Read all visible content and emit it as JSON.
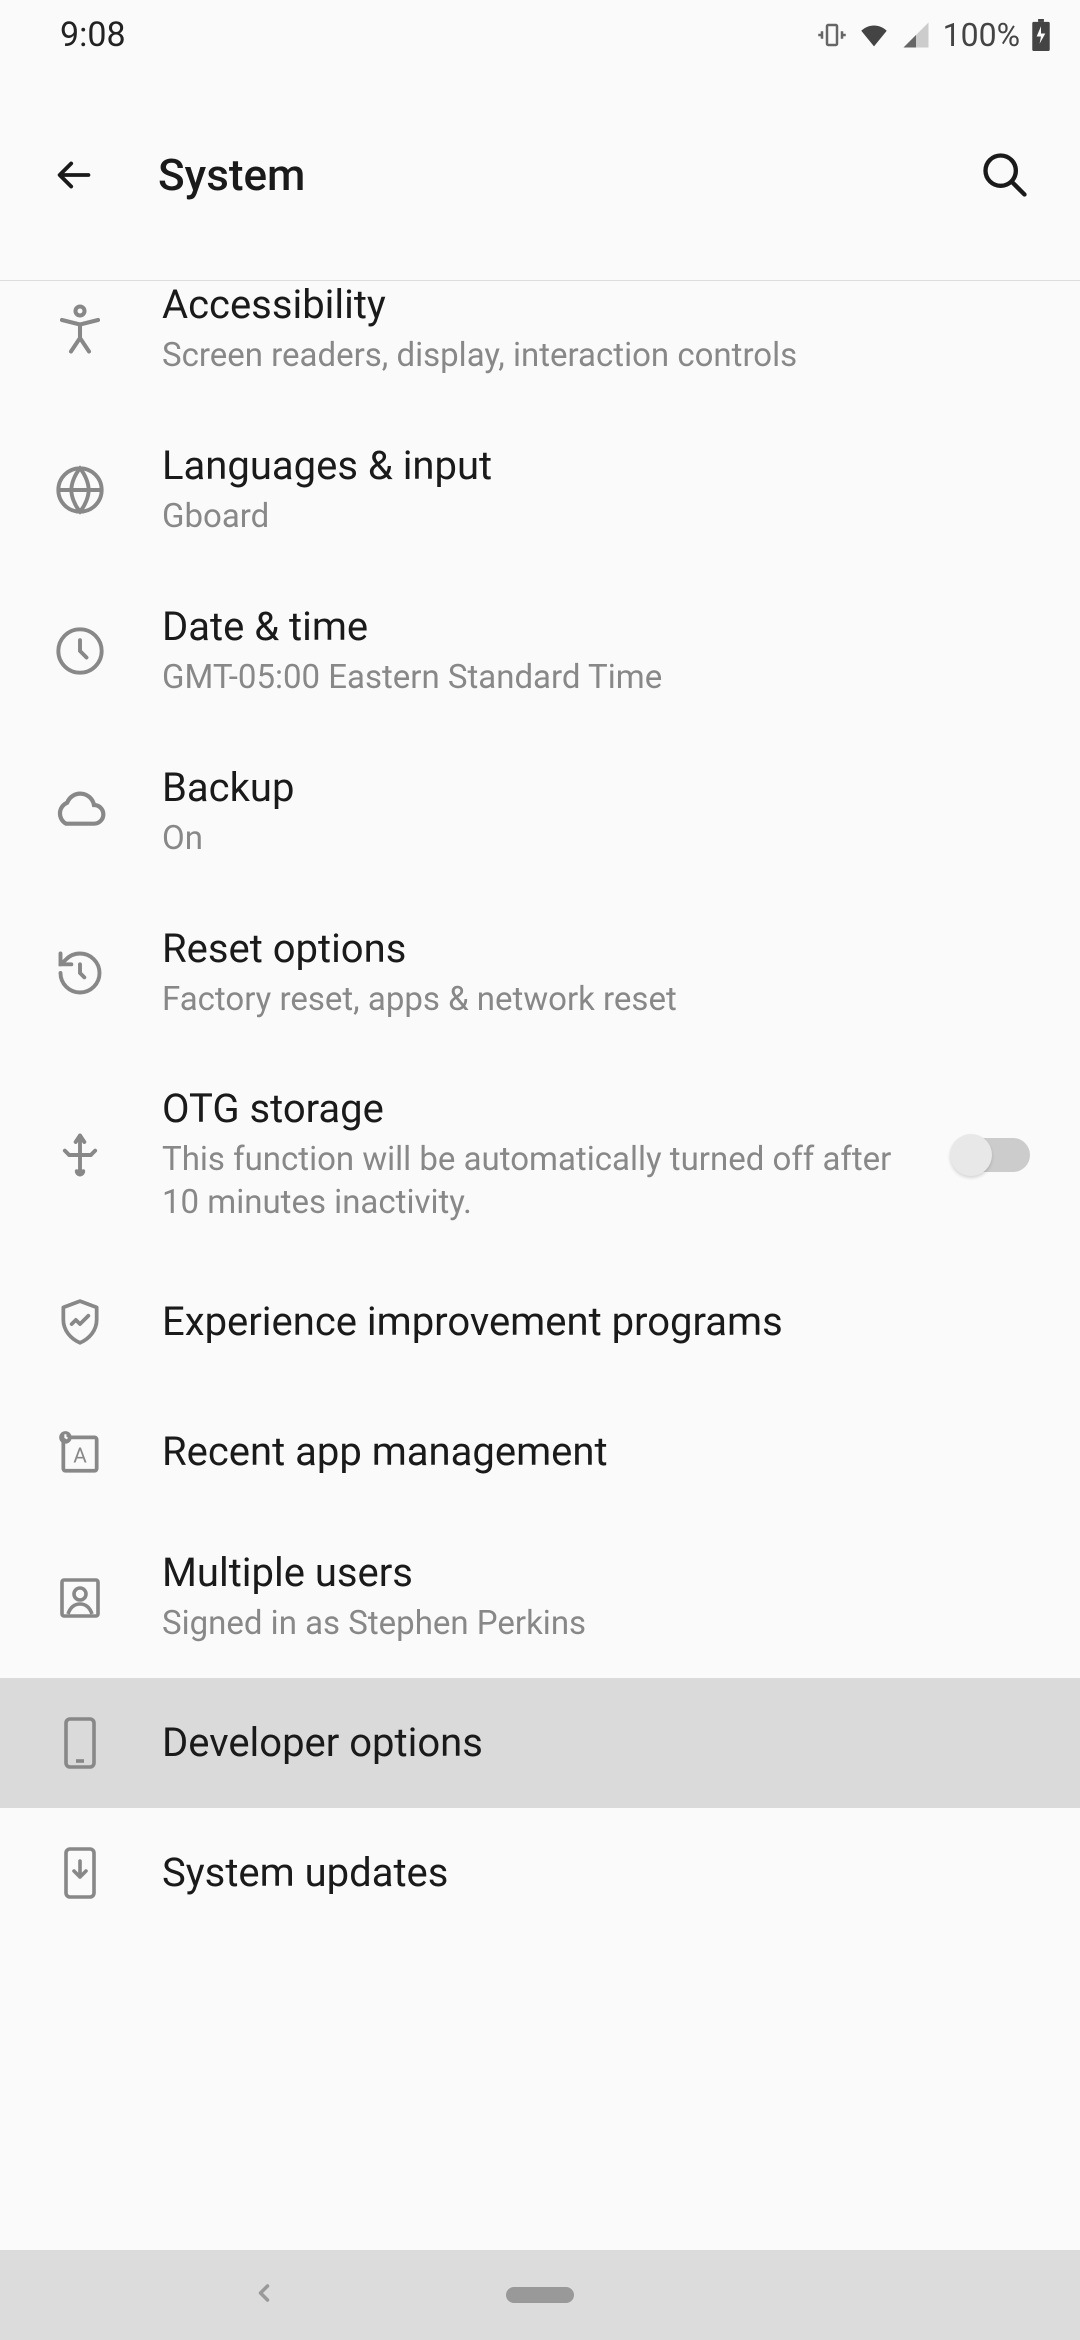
{
  "status": {
    "time": "9:08",
    "battery": "100%"
  },
  "header": {
    "title": "System"
  },
  "items": {
    "accessibility": {
      "title": "Accessibility",
      "sub": "Screen readers, display, interaction controls"
    },
    "languages": {
      "title": "Languages & input",
      "sub": "Gboard"
    },
    "datetime": {
      "title": "Date & time",
      "sub": "GMT-05:00 Eastern Standard Time"
    },
    "backup": {
      "title": "Backup",
      "sub": "On"
    },
    "reset": {
      "title": "Reset options",
      "sub": "Factory reset, apps & network reset"
    },
    "otg": {
      "title": "OTG storage",
      "sub": "This function will be automatically turned off after 10 minutes inactivity.",
      "toggle": false
    },
    "experience": {
      "title": "Experience improvement programs"
    },
    "recent": {
      "title": "Recent app management"
    },
    "users": {
      "title": "Multiple users",
      "sub": "Signed in as Stephen Perkins"
    },
    "developer": {
      "title": "Developer options"
    },
    "updates": {
      "title": "System updates"
    }
  }
}
